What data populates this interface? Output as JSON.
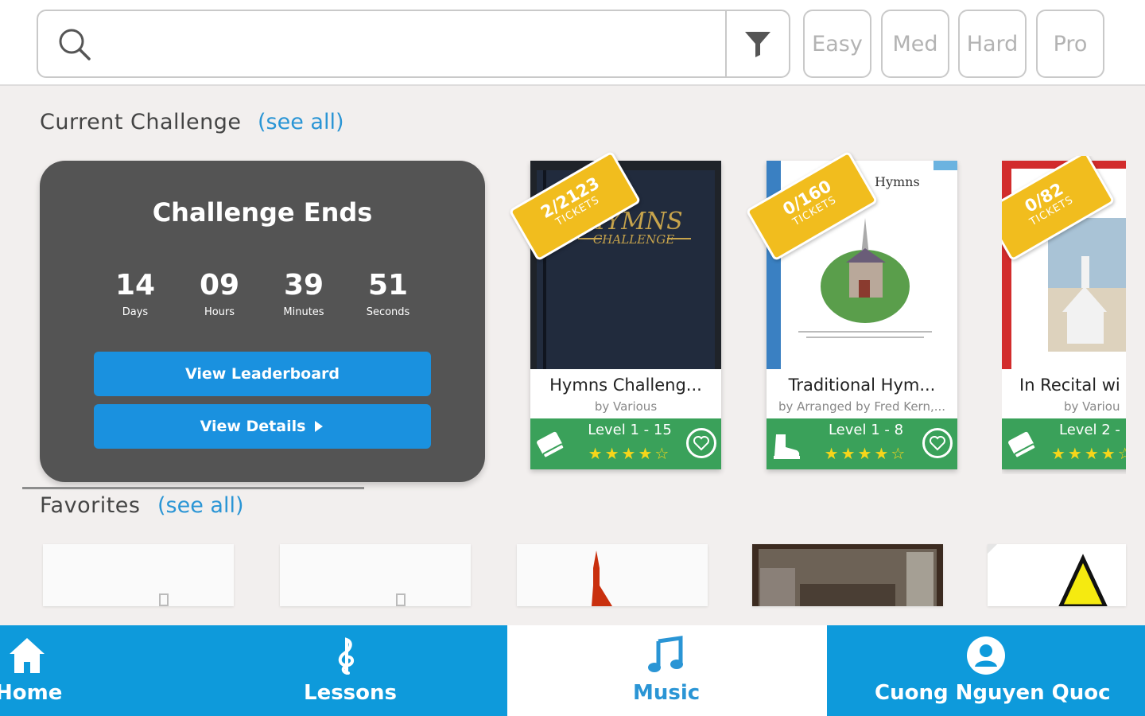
{
  "search": {
    "placeholder": "",
    "icon": "search-icon",
    "filter_icon": "filter-icon"
  },
  "difficulty_filters": [
    "Easy",
    "Med",
    "Hard",
    "Pro"
  ],
  "current_challenge": {
    "heading": "Current Challenge",
    "see_all": "(see all)",
    "card_title": "Challenge Ends",
    "countdown": [
      {
        "value": "14",
        "label": "Days"
      },
      {
        "value": "09",
        "label": "Hours"
      },
      {
        "value": "39",
        "label": "Minutes"
      },
      {
        "value": "51",
        "label": "Seconds"
      }
    ],
    "leaderboard_button": "View Leaderboard",
    "details_button": "View Details"
  },
  "books": [
    {
      "title": "Hymns Challeng...",
      "author": "by Various",
      "level": "Level 1 - 15",
      "rating": 4.5,
      "ticket_count": "2/2123",
      "ticket_word": "TICKETS",
      "cover_text": "HYMNS",
      "cover_subtext": "CHALLENGE",
      "kind_icon": "book-icon"
    },
    {
      "title": "Traditional Hym...",
      "author": "by Arranged by Fred Kern,...",
      "level": "Level 1 - 8",
      "rating": 4,
      "ticket_count": "0/160",
      "ticket_word": "TICKETS",
      "cover_text": "Hymns",
      "kind_icon": "boot-icon"
    },
    {
      "title": "In Recital wi",
      "author": "by Variou",
      "level": "Level 2 -",
      "rating": 4,
      "ticket_count": "0/82",
      "ticket_word": "TICKETS",
      "kind_icon": "book-icon"
    }
  ],
  "favorites": {
    "heading": "Favorites",
    "see_all": "(see all)"
  },
  "nav": [
    {
      "label": "Home",
      "icon": "home-icon",
      "active": false
    },
    {
      "label": "Lessons",
      "icon": "treble-clef-icon",
      "active": false
    },
    {
      "label": "Music",
      "icon": "music-note-icon",
      "active": true
    },
    {
      "label": "Cuong Nguyen Quoc",
      "icon": "user-icon",
      "active": false
    }
  ],
  "colors": {
    "accent_blue": "#0e9adb",
    "link_blue": "#2a95d5",
    "card_dark": "#545454",
    "book_footer_green": "#3aa15a",
    "ticket_yellow": "#f1bd1e",
    "star_yellow": "#f6d61a"
  }
}
